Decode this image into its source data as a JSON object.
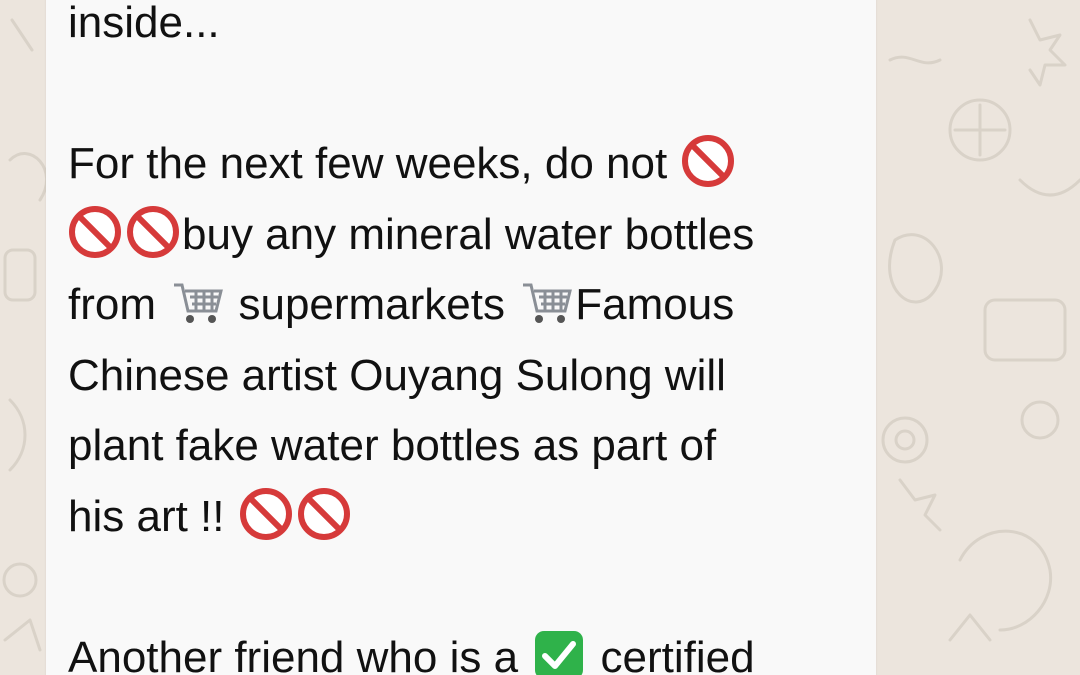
{
  "chat": {
    "message": {
      "line_top": "inside...",
      "para1": {
        "l1_text": "For the next few weeks, do not",
        "l2_text": "buy any mineral water bottles",
        "l3_a": "from",
        "l3_b": "supermarkets",
        "l3_c": "Famous",
        "l4": "Chinese artist Ouyang Sulong will",
        "l5": "plant fake water bottles as part of",
        "l6": "his art !!"
      },
      "para2": {
        "l1_a": "Another friend who is a",
        "l1_b": "certified"
      }
    },
    "icons": {
      "prohibited": "no-entry-sign-icon",
      "cart": "shopping-cart-icon",
      "check": "check-mark-button-icon"
    },
    "colors": {
      "wallpaper": "#ece5dd",
      "bubble": "#f9f9f9",
      "prohibited_red": "#d63a3a",
      "check_green": "#2fb24a"
    }
  }
}
